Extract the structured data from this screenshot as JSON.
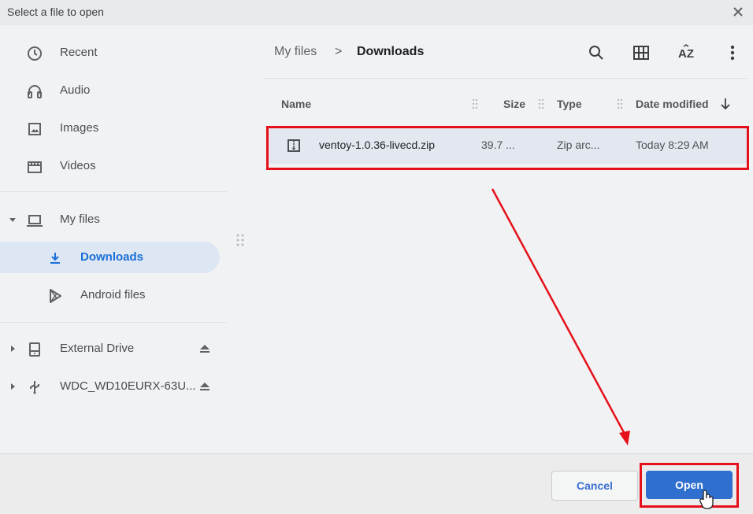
{
  "dialog": {
    "title": "Select a file to open"
  },
  "sidebar": {
    "recent": "Recent",
    "audio": "Audio",
    "images": "Images",
    "videos": "Videos",
    "my_files": "My files",
    "downloads": "Downloads",
    "android_files": "Android files",
    "external_drive": "External Drive",
    "wdc_drive": "WDC_WD10EURX-63U..."
  },
  "breadcrumb": {
    "root": "My files",
    "separator": ">",
    "current": "Downloads"
  },
  "toolbar": {
    "search_icon": "search-icon",
    "grid_icon": "grid-view-icon",
    "sort_icon": "sort-az-icon",
    "more_icon": "more-vert-icon"
  },
  "columns": {
    "name": "Name",
    "size": "Size",
    "type": "Type",
    "date": "Date modified",
    "sort_direction": "descending"
  },
  "files": [
    {
      "name": "ventoy-1.0.36-livecd.zip",
      "size": "39.7 ...",
      "type": "Zip arc...",
      "date": "Today 8:29 AM",
      "selected": true
    }
  ],
  "buttons": {
    "cancel": "Cancel",
    "open": "Open"
  },
  "colors": {
    "accent": "#2f6fcf",
    "selection": "#e3e8f0",
    "annotation": "#e5101a"
  }
}
